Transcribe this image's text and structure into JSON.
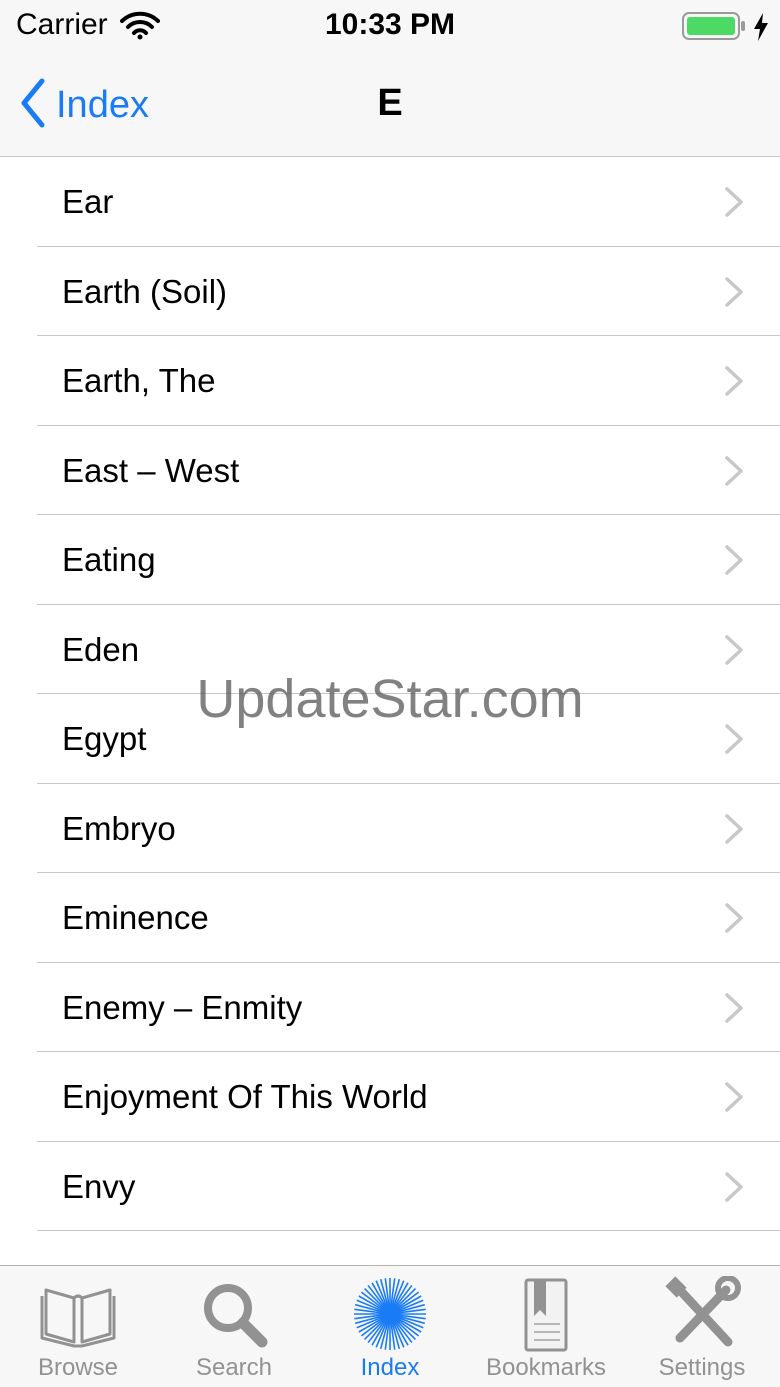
{
  "status_bar": {
    "carrier": "Carrier",
    "time": "10:33 PM"
  },
  "nav": {
    "back_label": "Index",
    "title": "E"
  },
  "list": {
    "items": [
      {
        "label": "Ear"
      },
      {
        "label": "Earth (Soil)"
      },
      {
        "label": "Earth, The"
      },
      {
        "label": "East – West"
      },
      {
        "label": "Eating"
      },
      {
        "label": "Eden"
      },
      {
        "label": "Egypt"
      },
      {
        "label": "Embryo"
      },
      {
        "label": "Eminence"
      },
      {
        "label": "Enemy – Enmity"
      },
      {
        "label": "Enjoyment Of This World"
      },
      {
        "label": "Envy"
      }
    ]
  },
  "watermark": "UpdateStar.com",
  "tab_bar": {
    "active_tab": "Index",
    "tabs": [
      {
        "label": "Browse",
        "icon": "book-icon"
      },
      {
        "label": "Search",
        "icon": "magnifier-icon"
      },
      {
        "label": "Index",
        "icon": "starburst-icon"
      },
      {
        "label": "Bookmarks",
        "icon": "bookmark-icon"
      },
      {
        "label": "Settings",
        "icon": "tools-icon"
      }
    ]
  },
  "colors": {
    "accent": "#1a7cf5",
    "inactive": "#929292",
    "separator": "#c8c7cc",
    "battery": "#4cd964"
  }
}
